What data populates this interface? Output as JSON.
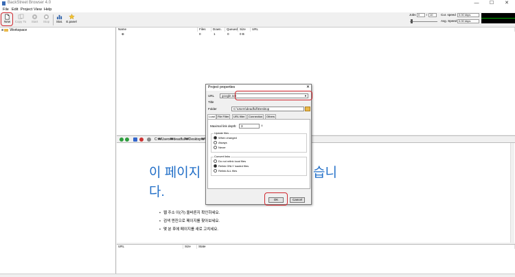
{
  "app": {
    "title": "BackStreet Browser 4.0",
    "window_controls": [
      "—",
      "☐",
      "✕"
    ]
  },
  "menu": [
    "File",
    "Edit",
    "Project",
    "View",
    "Help"
  ],
  "toolbar": {
    "buttons": [
      {
        "label": "New",
        "icon": "new-file-icon",
        "enabled": true
      },
      {
        "label": "Copy To",
        "icon": "copy-icon",
        "enabled": false
      },
      {
        "label": "Start",
        "icon": "play-icon",
        "enabled": false
      },
      {
        "label": "Stop",
        "icon": "stop-icon",
        "enabled": false
      },
      {
        "label": "Stat.",
        "icon": "stats-icon",
        "enabled": true
      },
      {
        "label": "E.panel",
        "icon": "star-icon",
        "enabled": true
      }
    ],
    "jobs_label": "Jobs",
    "jobs_value": "0",
    "jobs_sep": "/",
    "jobs_max": "10",
    "cur_speed_label": "Cur. speed",
    "cur_speed_value": "0.00 kbps",
    "avg_speed_label": "Avg. Speed",
    "avg_speed_value": "0.00 kbps"
  },
  "tree": {
    "root": "Workspace"
  },
  "project_list": {
    "columns": [
      "Name",
      "Files",
      "Down.",
      "Queued",
      "Size",
      "URL"
    ],
    "row": {
      "files": "0",
      "down": "1",
      "queued": "0",
      "size": "0 B"
    }
  },
  "viewer": {
    "address": "C:₩Users₩deadfull₩Desktop₩무실",
    "heading_line1": "이 페이지",
    "heading_tail": "습니",
    "heading_line2": "다.",
    "bullets": [
      "웹 주소  이(가) 올바른지 확인하세요.",
      "검색 엔진으로 페이지를 찾아보세요.",
      "몇 분 후에 페이지를 새로 고치세요."
    ]
  },
  "download_list": {
    "columns": [
      "URL",
      "Size",
      "State"
    ]
  },
  "dialog": {
    "title": "Project properties",
    "close": "✕",
    "url_label": "URL",
    "url_value": "google.net",
    "title_label": "Title",
    "title_value": "",
    "folder_label": "Folder",
    "folder_value": "C:\\Users\\deadfull\\Desktop",
    "tabs": [
      "Load",
      "File Filter",
      "URL filter",
      "Connection",
      "Others"
    ],
    "max_depth_label": "Maximal link depth:",
    "max_depth_value": "3",
    "update_group": "Update files",
    "update_options": [
      "When changed",
      "Always",
      "Never"
    ],
    "update_selected": 0,
    "convert_group": "Convert links",
    "convert_options": [
      "Do not relink local files",
      "Relink ONLY loaded files",
      "Relink ALL files"
    ],
    "convert_selected": 1,
    "ok_label": "OK",
    "cancel_label": "Cancel"
  },
  "colors": {
    "highlight": "#d0262d",
    "heading_blue": "#1f6dc7"
  }
}
